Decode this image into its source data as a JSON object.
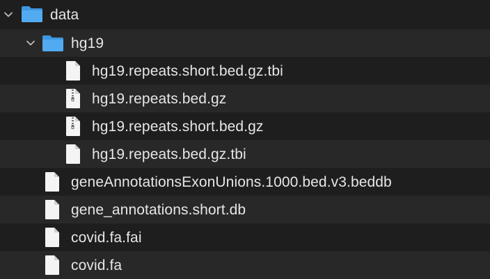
{
  "rows": [
    {
      "label": "data",
      "icon": "folder-icon",
      "expanded": true
    },
    {
      "label": "hg19",
      "icon": "folder-icon",
      "expanded": true
    },
    {
      "label": "hg19.repeats.short.bed.gz.tbi",
      "icon": "document-icon"
    },
    {
      "label": "hg19.repeats.bed.gz",
      "icon": "archive-icon"
    },
    {
      "label": "hg19.repeats.short.bed.gz",
      "icon": "archive-icon"
    },
    {
      "label": "hg19.repeats.bed.gz.tbi",
      "icon": "document-icon"
    },
    {
      "label": "geneAnnotationsExonUnions.1000.bed.v3.beddb",
      "icon": "document-icon"
    },
    {
      "label": "gene_annotations.short.db",
      "icon": "document-icon"
    },
    {
      "label": "covid.fa.fai",
      "icon": "document-icon"
    },
    {
      "label": "covid.fa",
      "icon": "document-icon"
    }
  ],
  "colors": {
    "background": "#1e1e1e",
    "stripe": "#282828",
    "text": "#e6e6e6",
    "folder": "#4aa5ea",
    "document": "#f5f5f5"
  }
}
